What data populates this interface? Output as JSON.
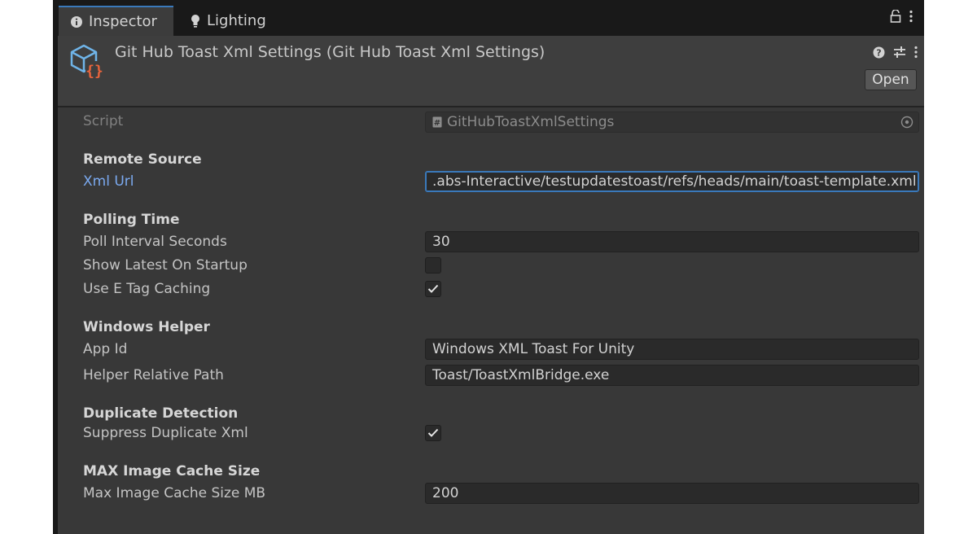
{
  "tabs": [
    {
      "label": "Inspector",
      "icon": "info-icon",
      "active": true
    },
    {
      "label": "Lighting",
      "icon": "bulb-icon",
      "active": false
    }
  ],
  "header": {
    "title": "Git Hub Toast Xml Settings (Git Hub Toast Xml Settings)",
    "open_label": "Open"
  },
  "script": {
    "label": "Script",
    "value": "GitHubToastXmlSettings"
  },
  "sections": {
    "remote_source": {
      "title": "Remote Source",
      "xml_url_label": "Xml Url",
      "xml_url_value": ".abs-Interactive/testupdatestoast/refs/heads/main/toast-template.xml"
    },
    "polling_time": {
      "title": "Polling Time",
      "poll_interval_label": "Poll Interval Seconds",
      "poll_interval_value": "30",
      "show_latest_label": "Show Latest On Startup",
      "show_latest_checked": false,
      "etag_label": "Use E Tag Caching",
      "etag_checked": true
    },
    "windows_helper": {
      "title": "Windows Helper",
      "app_id_label": "App Id",
      "app_id_value": "Windows XML Toast For Unity",
      "helper_path_label": "Helper Relative Path",
      "helper_path_value": "Toast/ToastXmlBridge.exe"
    },
    "duplicate_detection": {
      "title": "Duplicate Detection",
      "suppress_label": "Suppress Duplicate Xml",
      "suppress_checked": true
    },
    "max_image_cache": {
      "title": "MAX Image Cache Size",
      "size_label": "Max Image Cache Size MB",
      "size_value": "200"
    }
  },
  "colors": {
    "panel_bg": "#383838",
    "tabbar_bg": "#191919",
    "accent": "#3a79bb",
    "link_label": "#7baaf0",
    "script_icon_orange": "#e8643c",
    "script_icon_blue": "#6fb4e8"
  }
}
